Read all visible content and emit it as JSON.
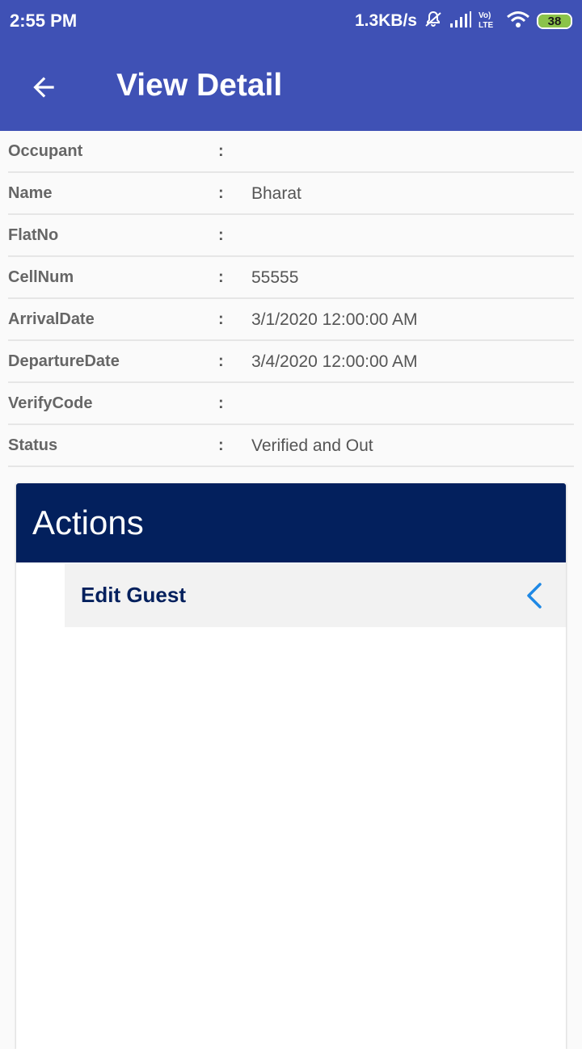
{
  "status_bar": {
    "time": "2:55 PM",
    "network_speed": "1.3KB/s",
    "battery_level": "38",
    "icons": [
      "mute-bell-icon",
      "signal-icon",
      "volte-icon",
      "wifi-icon",
      "battery-icon"
    ]
  },
  "appbar": {
    "title": "View Detail",
    "back_icon": "arrow-left-icon"
  },
  "details": {
    "separator": ":",
    "rows": [
      {
        "label": "Occupant",
        "value": ""
      },
      {
        "label": "Name",
        "value": "Bharat"
      },
      {
        "label": "FlatNo",
        "value": ""
      },
      {
        "label": "CellNum",
        "value": "55555"
      },
      {
        "label": "ArrivalDate",
        "value": "3/1/2020 12:00:00 AM"
      },
      {
        "label": "DepartureDate",
        "value": "3/4/2020 12:00:00 AM"
      },
      {
        "label": "VerifyCode",
        "value": ""
      },
      {
        "label": "Status",
        "value": "Verified and Out"
      }
    ]
  },
  "actions": {
    "title": "Actions",
    "items": [
      {
        "label": "Edit Guest",
        "icon": "chevron-left-icon"
      }
    ]
  },
  "colors": {
    "primary": "#3f51b5",
    "actions_header": "#03205d",
    "chevron": "#1e88e5"
  }
}
